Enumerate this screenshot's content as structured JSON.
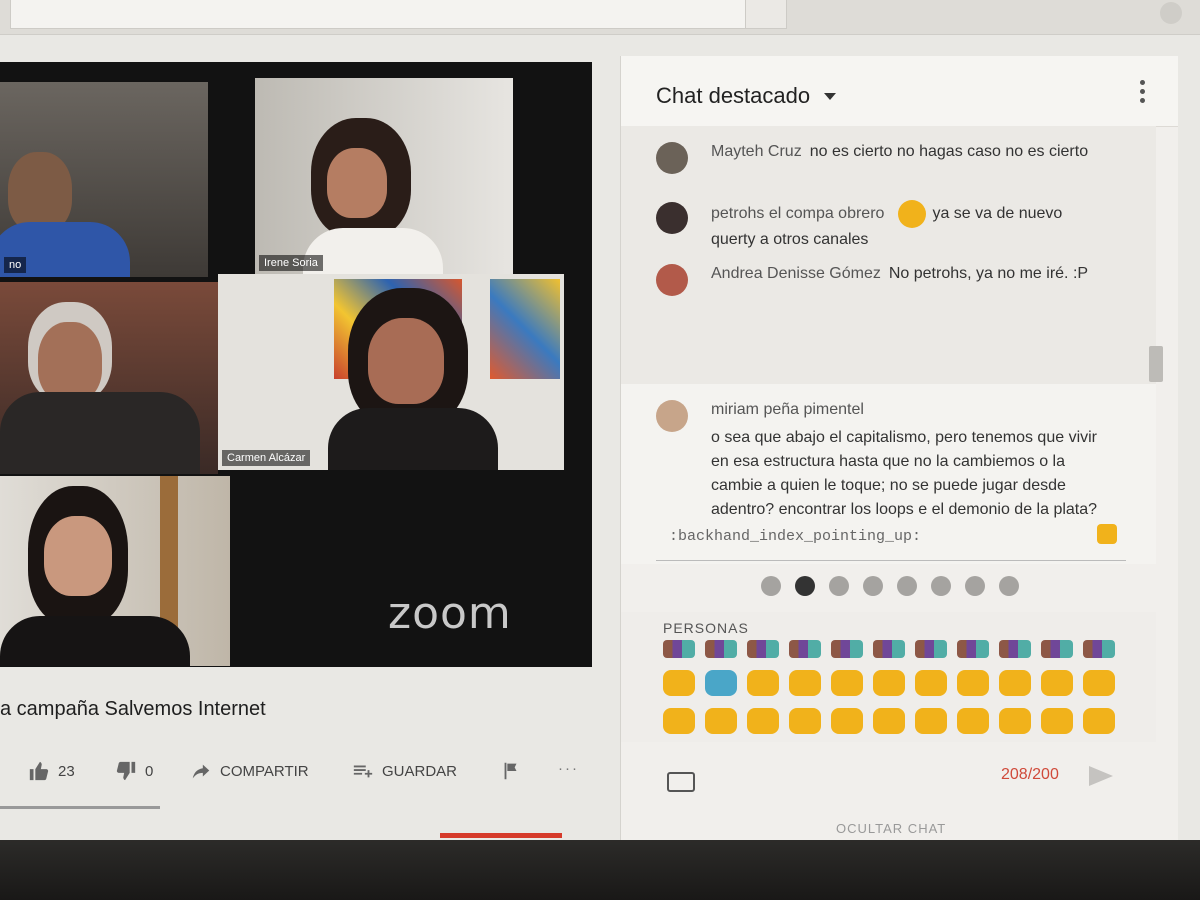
{
  "video": {
    "participants": [
      {
        "name": "no",
        "label_visible": true
      },
      {
        "name": "Irene Soria",
        "label_visible": true
      },
      {
        "name": "",
        "label_visible": false
      },
      {
        "name": "Carmen Alcázar",
        "label_visible": true,
        "active_speaker": true
      },
      {
        "name": "",
        "label_visible": false
      }
    ],
    "logo": "zoom"
  },
  "title": "a campaña Salvemos Internet",
  "actions": {
    "like_count": "23",
    "dislike_count": "0",
    "share_label": "COMPARTIR",
    "save_label": "GUARDAR",
    "more_label": "···"
  },
  "chat": {
    "title": "Chat destacado",
    "messages": [
      {
        "author": "Mayteh Cruz",
        "text": "no es cierto no hagas caso no es cierto",
        "avatar_color": "#6b6258"
      },
      {
        "author": "petrohs el compa obrero",
        "text": "ya se va de nuevo querty a otros canales",
        "emoji": "pensive-face",
        "avatar_color": "#3a2f2e"
      },
      {
        "author": "Andrea Denisse Gómez",
        "text": "No petrohs, ya no me iré. :P",
        "avatar_color": "#b25a4a"
      },
      {
        "author": "miriam peña pimentel",
        "text": "o sea que abajo el capitalismo, pero tenemos que vivir en esa estructura hasta que no la cambiemos o la cambie a quien le toque; no se puede jugar desde adentro? encontrar los loops e el demonio de la plata?",
        "avatar_color": "#c7a58a"
      }
    ],
    "input_text": ":backhand_index_pointing_up:",
    "emoji_category": "PERSONAS",
    "char_counter": "208/200",
    "hide_chat": "OCULTAR CHAT"
  },
  "colors": {
    "active_speaker": "#6ac94a",
    "counter_over": "#d04a3a",
    "emoji_yellow": "#f1b21b"
  }
}
